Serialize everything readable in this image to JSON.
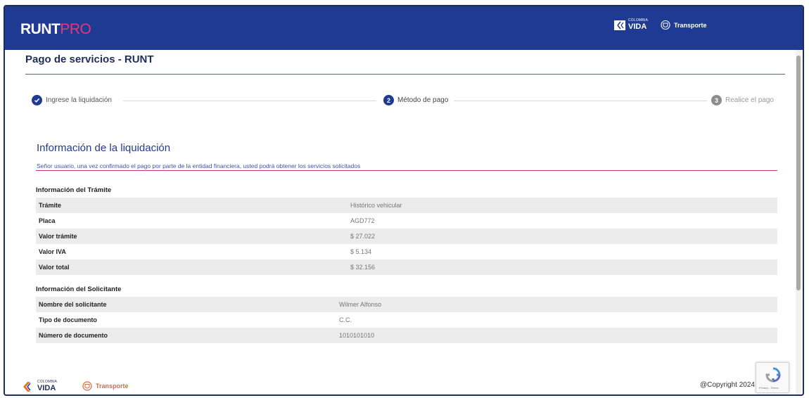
{
  "header": {
    "logo_primary": "RUNT",
    "logo_secondary": "PRO",
    "badge_cv_small": "COLOMBIA",
    "badge_cv_big": "VIDA",
    "badge_transporte": "Transporte"
  },
  "page": {
    "title": "Pago de servicios - RUNT"
  },
  "stepper": {
    "steps": [
      {
        "number": "✓",
        "label": "Ingrese la liquidación",
        "state": "done"
      },
      {
        "number": "2",
        "label": "Método de pago",
        "state": "active"
      },
      {
        "number": "3",
        "label": "Realice el pago",
        "state": "pending"
      }
    ]
  },
  "section": {
    "title": "Información de la liquidación",
    "subtitle": "Señor usuario, una vez confirmado el pago por parte de la entidad financiera, usted podrá obtener los servicios solicitados"
  },
  "tramite": {
    "heading": "Información del Trámite",
    "rows": [
      {
        "label": "Trámite",
        "value": "Histórico vehicular"
      },
      {
        "label": "Placa",
        "value": "AGD772"
      },
      {
        "label": "Valor trámite",
        "value": "$ 27.022"
      },
      {
        "label": "Valor IVA",
        "value": "$ 5.134"
      },
      {
        "label": "Valor total",
        "value": "$ 32.156"
      }
    ]
  },
  "solicitante": {
    "heading": "Información del Solicitante",
    "rows": [
      {
        "label": "Nombre del solicitante",
        "value": "Wilmer Alfonso"
      },
      {
        "label": "Tipo de documento",
        "value": "C.C."
      },
      {
        "label": "Número de documento",
        "value": "1010101010"
      }
    ]
  },
  "footer": {
    "cv_small": "COLOMBIA",
    "cv_big": "VIDA",
    "transporte": "Transporte",
    "copyright": "@Copyright 2024 R"
  },
  "recaptcha": {
    "text": "Privacy - Terms"
  },
  "colors": {
    "header_bg": "#1f3a93",
    "accent_pink": "#c8327a",
    "step_done": "#1f3a93",
    "step_pending": "#8c8c8c"
  }
}
